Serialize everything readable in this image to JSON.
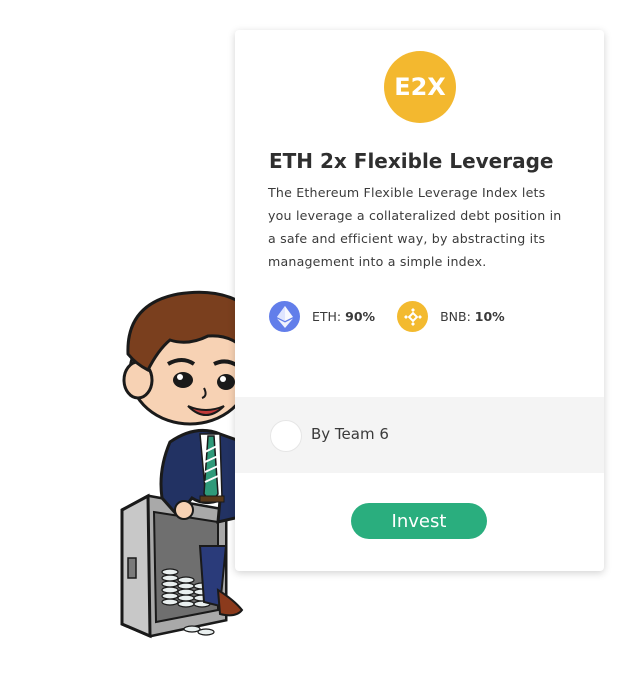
{
  "product": {
    "badge_text": "E2X",
    "badge_color": "#f3b82f",
    "title": "ETH 2x Flexible Leverage",
    "description": "The Ethereum Flexible Leverage Index lets you leverage a collateralized debt position in a safe and efficient way, by abstracting its management into a simple index."
  },
  "allocations": [
    {
      "symbol_label": "ETH:",
      "percent": "90%",
      "icon": "ethereum-icon",
      "color": "#627eea"
    },
    {
      "symbol_label": "BNB:",
      "percent": "10%",
      "icon": "binance-icon",
      "color": "#f3ba2f"
    }
  ],
  "author": {
    "label": "By Team 6"
  },
  "actions": {
    "invest_label": "Invest",
    "invest_color": "#2aae7e"
  },
  "illustration": {
    "icon": "mascot-with-safe-illustration"
  }
}
